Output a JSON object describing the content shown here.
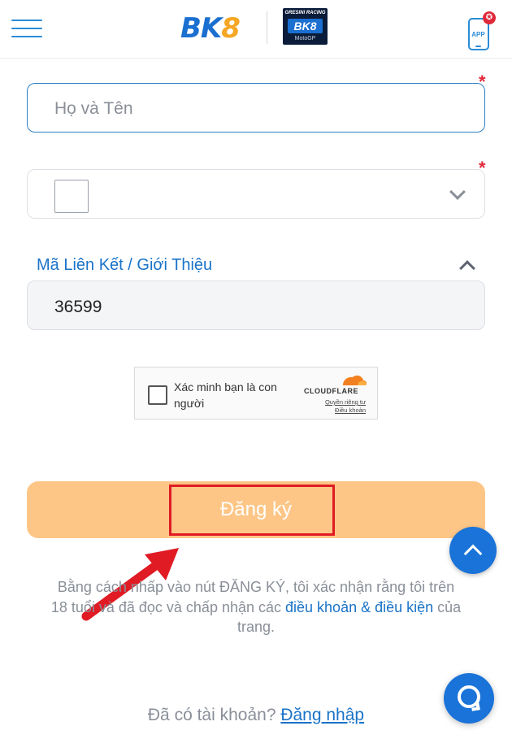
{
  "header": {
    "logo_bk": "BK",
    "logo_8": "8",
    "partner_top": "GRESINI RACING",
    "partner_mid": "BK8",
    "partner_bot": "MotoGP",
    "app_label": "APP",
    "app_badge": "✪"
  },
  "form": {
    "name_placeholder": "Họ và Tên",
    "required_mark": "*",
    "referral_label": "Mã Liên Kết / Giới Thiệu",
    "referral_value": "36599"
  },
  "captcha": {
    "label": "Xác minh bạn là con người",
    "brand": "CLOUDFLARE",
    "privacy_link": "Quyền riêng tư",
    "terms_link": "Điều khoản"
  },
  "register": {
    "label": "Đăng ký"
  },
  "terms": {
    "before": "Bằng cách nhấp vào nút ĐĂNG KÝ, tôi xác nhận rằng tôi trên 18 tuổi và đã đọc và chấp nhận các ",
    "link": "điều khoản & điều kiện",
    "after": " của trang."
  },
  "login": {
    "prompt": "Đã có tài khoản? ",
    "link": "Đăng nhập"
  },
  "colors": {
    "accent_blue": "#1a73c8",
    "register_button": "#fdc687",
    "highlight_red": "#e01b24"
  }
}
